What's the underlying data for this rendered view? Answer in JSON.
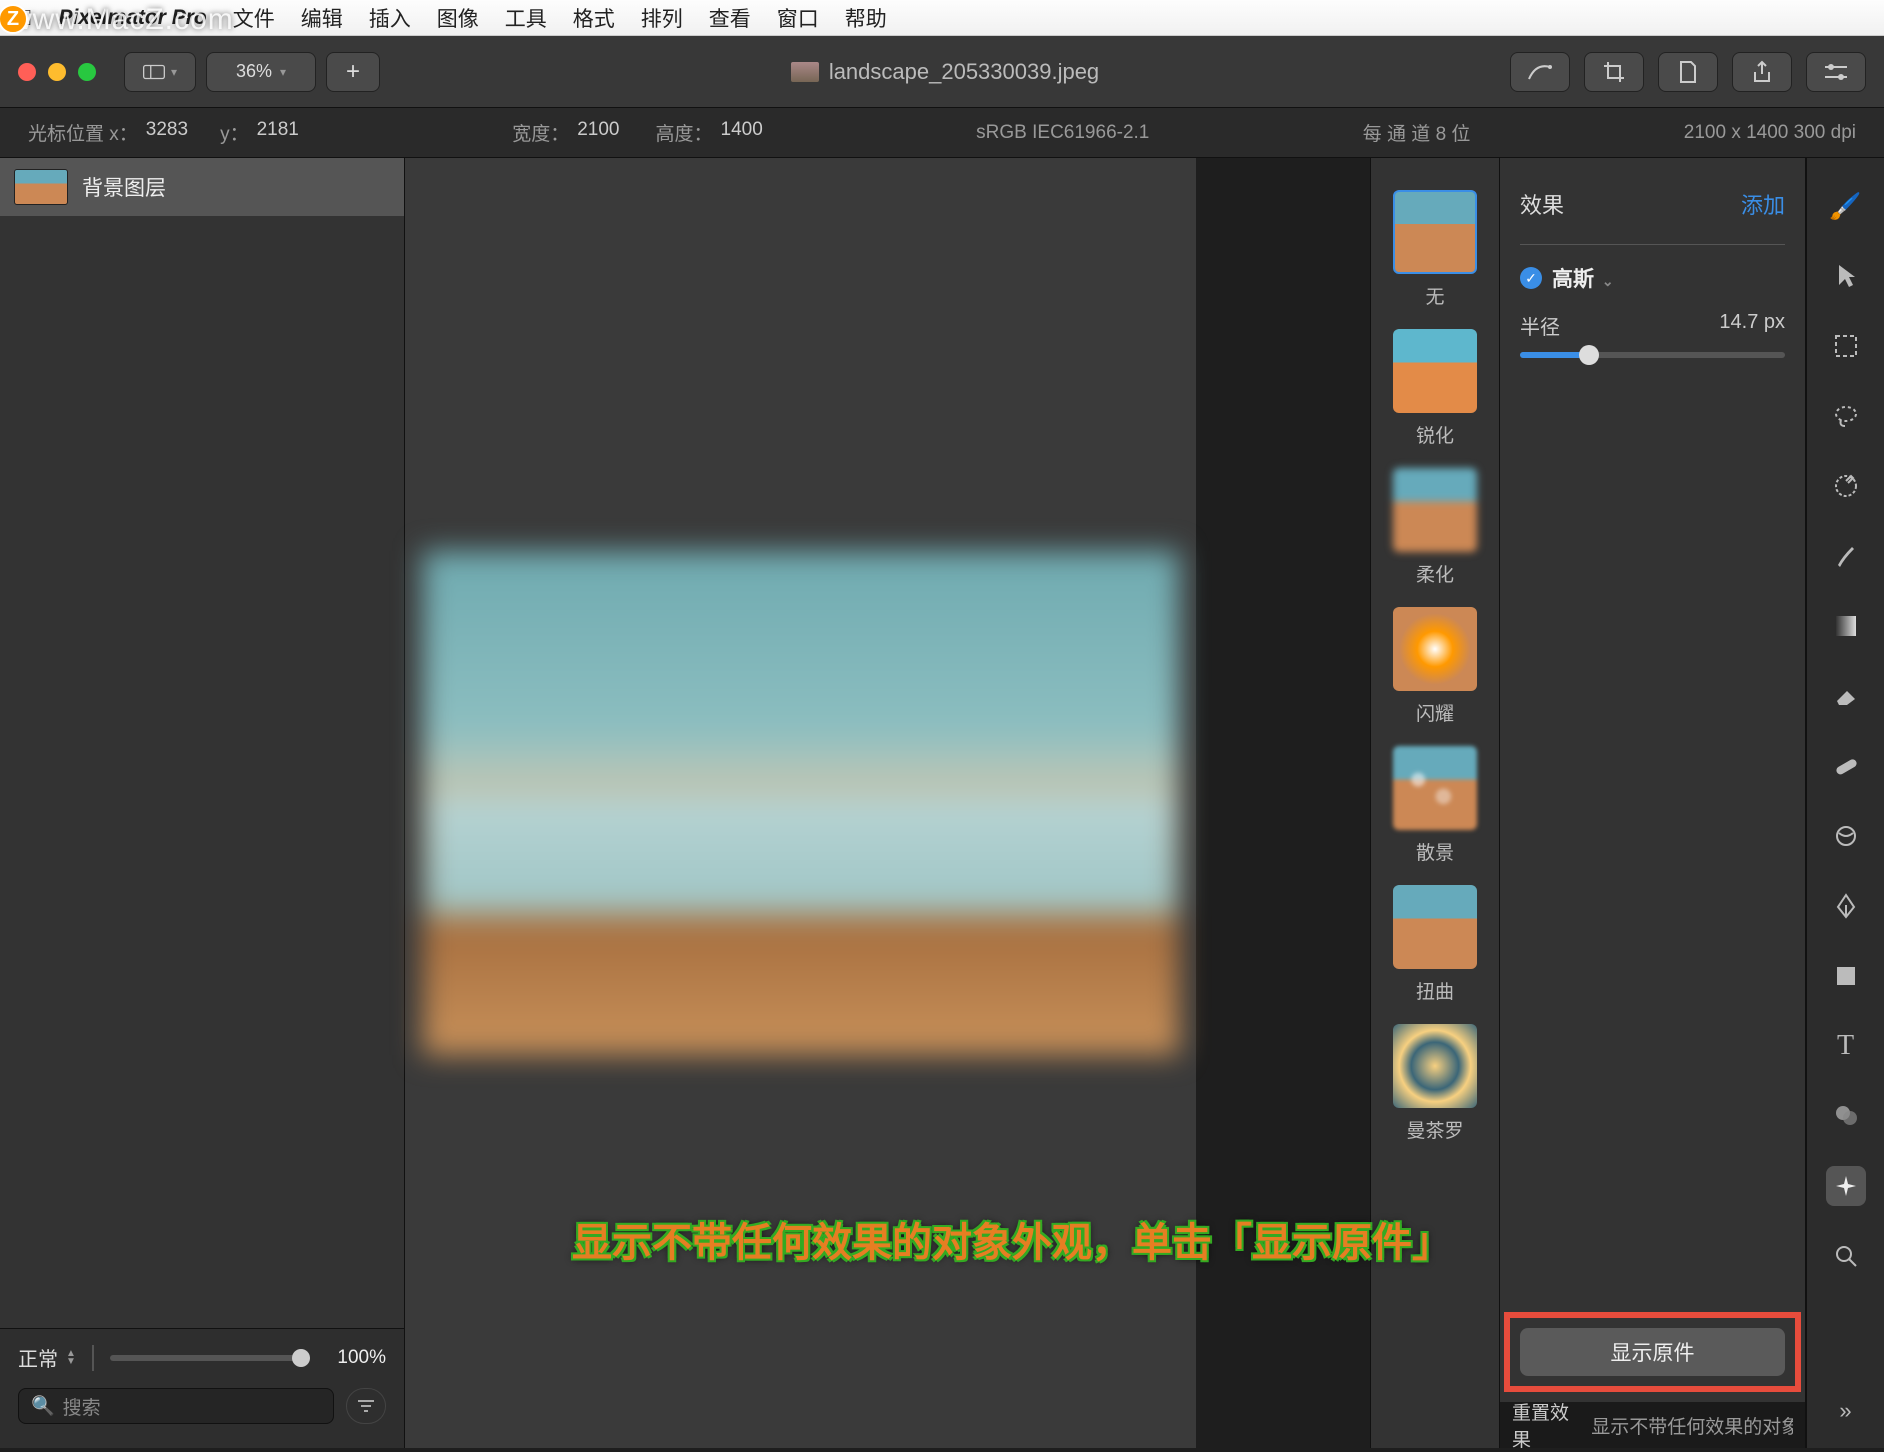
{
  "menubar": {
    "app_name": "Pixelmator Pro",
    "items": [
      "文件",
      "编辑",
      "插入",
      "图像",
      "工具",
      "格式",
      "排列",
      "查看",
      "窗口",
      "帮助"
    ]
  },
  "watermark": "www.MacZ.com",
  "titlebar": {
    "zoom": "36%",
    "doc_title": "landscape_205330039.jpeg"
  },
  "infobar": {
    "cursor_label": "光标位置 x：",
    "cursor_x": "3283",
    "cursor_y_label": "y：",
    "cursor_y": "2181",
    "width_label": "宽度：",
    "width": "2100",
    "height_label": "高度：",
    "height": "1400",
    "colorspace": "sRGB IEC61966-2.1",
    "bitdepth": "每 通 道 8 位",
    "dims": "2100 x 1400 300 dpi"
  },
  "layers": {
    "bg_layer": "背景图层"
  },
  "leftfoot": {
    "blend": "正常",
    "opacity": "100%",
    "search_ph": "搜索"
  },
  "presets": {
    "none": "无",
    "sharpen": "锐化",
    "soften": "柔化",
    "shine": "闪耀",
    "bokeh": "散景",
    "distort": "扭曲",
    "mandala": "曼茶罗"
  },
  "effects": {
    "title": "效果",
    "add": "添加",
    "gaussian": "高斯",
    "radius_label": "半径",
    "radius_value": "14.7 px"
  },
  "footer": {
    "show_original": "显示原件",
    "reset": "重置效果",
    "reset_desc": "显示不带任何效果的对象外"
  },
  "annotation": "显示不带任何效果的对象外观，单击「显示原件」"
}
